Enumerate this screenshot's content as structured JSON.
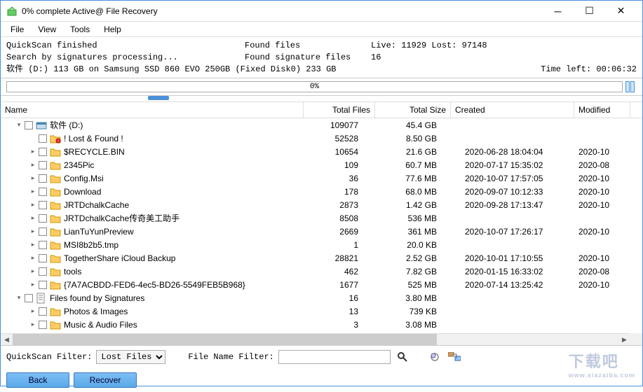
{
  "window": {
    "title": "0% complete Active@ File Recovery"
  },
  "menu": {
    "file": "File",
    "view": "View",
    "tools": "Tools",
    "help": "Help"
  },
  "status": {
    "line1a": "QuickScan finished",
    "line1b": "Found files",
    "line1c": "Live: 11929 Lost: 97148",
    "line2a": "Search by signatures processing...",
    "line2b": "Found signature files",
    "line2c": "16",
    "line3": "软件 (D:) 113 GB on Samsung SSD 860 EVO 250GB (Fixed Disk0) 233 GB",
    "timeleft_label": "Time left:",
    "timeleft": "00:06:32"
  },
  "progress": {
    "text": "0%"
  },
  "columns": {
    "name": "Name",
    "files": "Total Files",
    "size": "Total Size",
    "created": "Created",
    "modified": "Modified"
  },
  "rows": [
    {
      "depth": 0,
      "exp": "▾",
      "icon": "drive",
      "name": "软件 (D:)",
      "files": "109077",
      "size": "45.4 GB",
      "created": "",
      "modified": ""
    },
    {
      "depth": 1,
      "exp": "",
      "icon": "folder-warn",
      "name": "! Lost & Found !",
      "files": "52528",
      "size": "8.50 GB",
      "created": "",
      "modified": ""
    },
    {
      "depth": 1,
      "exp": "▸",
      "icon": "folder",
      "name": "$RECYCLE.BIN",
      "files": "10654",
      "size": "21.6 GB",
      "created": "2020-06-28 18:04:04",
      "modified": "2020-10"
    },
    {
      "depth": 1,
      "exp": "▸",
      "icon": "folder",
      "name": "2345Pic",
      "files": "109",
      "size": "60.7 MB",
      "created": "2020-07-17 15:35:02",
      "modified": "2020-08"
    },
    {
      "depth": 1,
      "exp": "▸",
      "icon": "folder",
      "name": "Config.Msi",
      "files": "36",
      "size": "77.6 MB",
      "created": "2020-10-07 17:57:05",
      "modified": "2020-10"
    },
    {
      "depth": 1,
      "exp": "▸",
      "icon": "folder",
      "name": "Download",
      "files": "178",
      "size": "68.0 MB",
      "created": "2020-09-07 10:12:33",
      "modified": "2020-10"
    },
    {
      "depth": 1,
      "exp": "▸",
      "icon": "folder",
      "name": "JRTDchalkCache",
      "files": "2873",
      "size": "1.42 GB",
      "created": "2020-09-28 17:13:47",
      "modified": "2020-10"
    },
    {
      "depth": 1,
      "exp": "▸",
      "icon": "folder",
      "name": "JRTDchalkCache传奇美工助手",
      "files": "8508",
      "size": "536 MB",
      "created": "",
      "modified": ""
    },
    {
      "depth": 1,
      "exp": "▸",
      "icon": "folder",
      "name": "LianTuYunPreview",
      "files": "2669",
      "size": "361 MB",
      "created": "2020-10-07 17:26:17",
      "modified": "2020-10"
    },
    {
      "depth": 1,
      "exp": "▸",
      "icon": "folder",
      "name": "MSI8b2b5.tmp",
      "files": "1",
      "size": "20.0 KB",
      "created": "",
      "modified": ""
    },
    {
      "depth": 1,
      "exp": "▸",
      "icon": "folder",
      "name": "TogetherShare iCloud Backup",
      "files": "28821",
      "size": "2.52 GB",
      "created": "2020-10-01 17:10:55",
      "modified": "2020-10"
    },
    {
      "depth": 1,
      "exp": "▸",
      "icon": "folder",
      "name": "tools",
      "files": "462",
      "size": "7.82 GB",
      "created": "2020-01-15 16:33:02",
      "modified": "2020-08"
    },
    {
      "depth": 1,
      "exp": "▸",
      "icon": "folder",
      "name": "{7A7ACBDD-FED6-4ec5-BD26-5549FEB5B968}",
      "files": "1677",
      "size": "525 MB",
      "created": "2020-07-14 13:25:42",
      "modified": "2020-10"
    },
    {
      "depth": 0,
      "exp": "▾",
      "icon": "sig",
      "name": "Files found by Signatures",
      "files": "16",
      "size": "3.80 MB",
      "created": "",
      "modified": ""
    },
    {
      "depth": 1,
      "exp": "▸",
      "icon": "folder",
      "name": "Photos & Images",
      "files": "13",
      "size": "739 KB",
      "created": "",
      "modified": ""
    },
    {
      "depth": 1,
      "exp": "▸",
      "icon": "folder",
      "name": "Music & Audio Files",
      "files": "3",
      "size": "3.08 MB",
      "created": "",
      "modified": ""
    }
  ],
  "filter": {
    "quickscan_label": "QuickScan Filter:",
    "quickscan_value": "Lost Files",
    "filename_label": "File Name Filter:",
    "filename_value": ""
  },
  "buttons": {
    "back": "Back",
    "recover": "Recover"
  },
  "watermark": {
    "main": "下载吧",
    "sub": "www.xiazaiba.com"
  }
}
